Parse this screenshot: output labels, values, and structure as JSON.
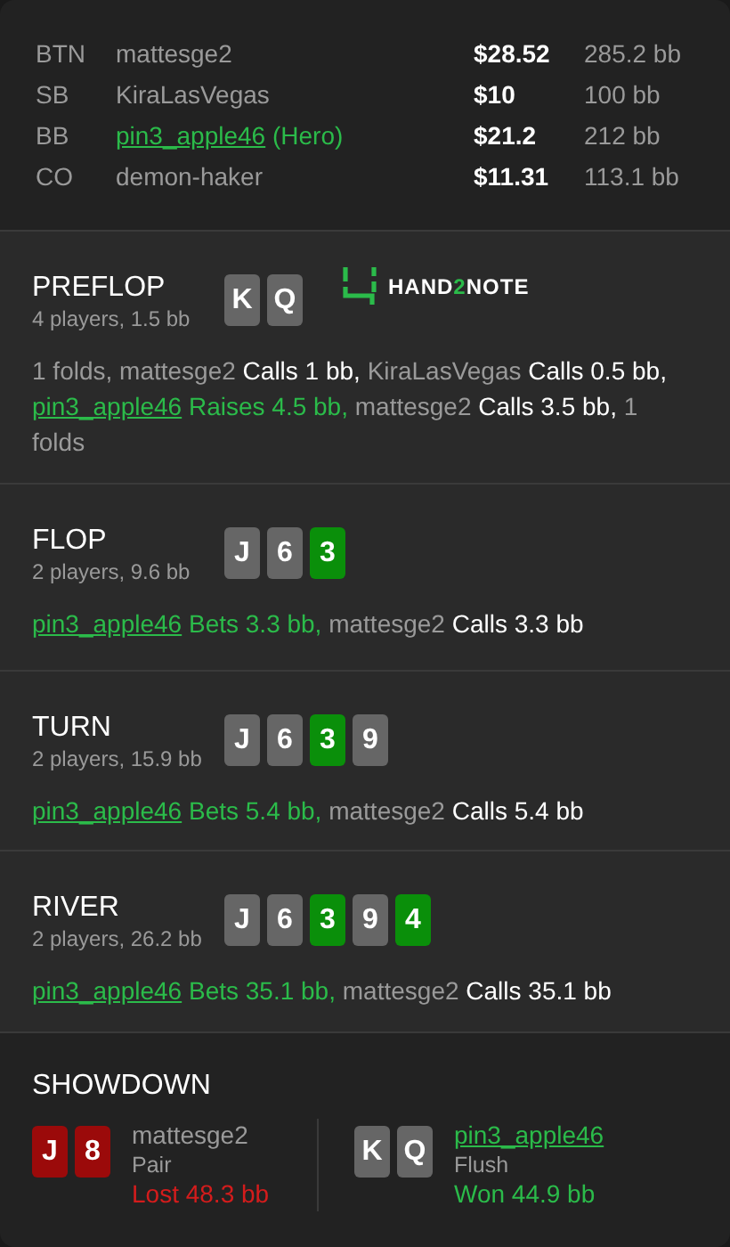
{
  "players": [
    {
      "position": "BTN",
      "name": "mattesge2",
      "hero": false,
      "stack": "$28.52",
      "stack_bb": "285.2 bb"
    },
    {
      "position": "SB",
      "name": "KiraLasVegas",
      "hero": false,
      "stack": "$10",
      "stack_bb": "100 bb"
    },
    {
      "position": "BB",
      "name": "pin3_apple46",
      "hero": true,
      "suffix": " (Hero)",
      "stack": "$21.2",
      "stack_bb": "212 bb"
    },
    {
      "position": "CO",
      "name": "demon-haker",
      "hero": false,
      "stack": "$11.31",
      "stack_bb": "113.1 bb"
    }
  ],
  "logo": {
    "before": "HAND",
    "accent": "2",
    "after": "NOTE"
  },
  "streets": [
    {
      "name": "PREFLOP",
      "info": "4 players, 1.5 bb",
      "logo": true,
      "cards": [
        {
          "rank": "K",
          "color": "#666666"
        },
        {
          "rank": "Q",
          "color": "#666666"
        }
      ],
      "actions": [
        {
          "kind": "plain",
          "text": "1 folds, "
        },
        {
          "kind": "player",
          "text": "mattesge2 "
        },
        {
          "kind": "action",
          "text": "Calls 1 bb, "
        },
        {
          "kind": "player",
          "text": "KiraLasVegas "
        },
        {
          "kind": "action",
          "text": "Calls 0.5 bb, "
        },
        {
          "kind": "hero",
          "text": "pin3_apple46"
        },
        {
          "kind": "hero_action",
          "text": " Raises 4.5 bb, "
        },
        {
          "kind": "player",
          "text": "mattesge2 "
        },
        {
          "kind": "action",
          "text": "Calls 3.5 bb, "
        },
        {
          "kind": "plain",
          "text": "1 folds"
        }
      ]
    },
    {
      "name": "FLOP",
      "info": "2 players, 9.6 bb",
      "logo": false,
      "cards": [
        {
          "rank": "J",
          "color": "#666666"
        },
        {
          "rank": "6",
          "color": "#666666"
        },
        {
          "rank": "3",
          "color": "#0a8f0a"
        }
      ],
      "actions": [
        {
          "kind": "hero",
          "text": "pin3_apple46"
        },
        {
          "kind": "hero_action",
          "text": " Bets 3.3 bb, "
        },
        {
          "kind": "player",
          "text": "mattesge2 "
        },
        {
          "kind": "action",
          "text": "Calls 3.3 bb"
        }
      ]
    },
    {
      "name": "TURN",
      "info": "2 players, 15.9 bb",
      "logo": false,
      "cards": [
        {
          "rank": "J",
          "color": "#666666"
        },
        {
          "rank": "6",
          "color": "#666666"
        },
        {
          "rank": "3",
          "color": "#0a8f0a"
        },
        {
          "rank": "9",
          "color": "#666666"
        }
      ],
      "actions": [
        {
          "kind": "hero",
          "text": "pin3_apple46"
        },
        {
          "kind": "hero_action",
          "text": " Bets 5.4 bb, "
        },
        {
          "kind": "player",
          "text": "mattesge2 "
        },
        {
          "kind": "action",
          "text": "Calls 5.4 bb"
        }
      ]
    },
    {
      "name": "RIVER",
      "info": "2 players, 26.2 bb",
      "logo": false,
      "cards": [
        {
          "rank": "J",
          "color": "#666666"
        },
        {
          "rank": "6",
          "color": "#666666"
        },
        {
          "rank": "3",
          "color": "#0a8f0a"
        },
        {
          "rank": "9",
          "color": "#666666"
        },
        {
          "rank": "4",
          "color": "#0a8f0a"
        }
      ],
      "actions": [
        {
          "kind": "hero",
          "text": "pin3_apple46"
        },
        {
          "kind": "hero_action",
          "text": " Bets 35.1 bb, "
        },
        {
          "kind": "player",
          "text": "mattesge2 "
        },
        {
          "kind": "action",
          "text": "Calls 35.1 bb"
        }
      ]
    }
  ],
  "showdown": {
    "title": "SHOWDOWN",
    "hands": [
      {
        "cards": [
          {
            "rank": "J",
            "color": "#9b0a0a"
          },
          {
            "rank": "8",
            "color": "#9b0a0a"
          }
        ],
        "name": "mattesge2",
        "hero": false,
        "hand": "Pair",
        "result": "Lost 48.3 bb",
        "kind": "lost"
      },
      {
        "cards": [
          {
            "rank": "K",
            "color": "#666666"
          },
          {
            "rank": "Q",
            "color": "#666666"
          }
        ],
        "name": "pin3_apple46",
        "hero": true,
        "hand": "Flush",
        "result": "Won 44.9 bb",
        "kind": "won"
      }
    ]
  }
}
